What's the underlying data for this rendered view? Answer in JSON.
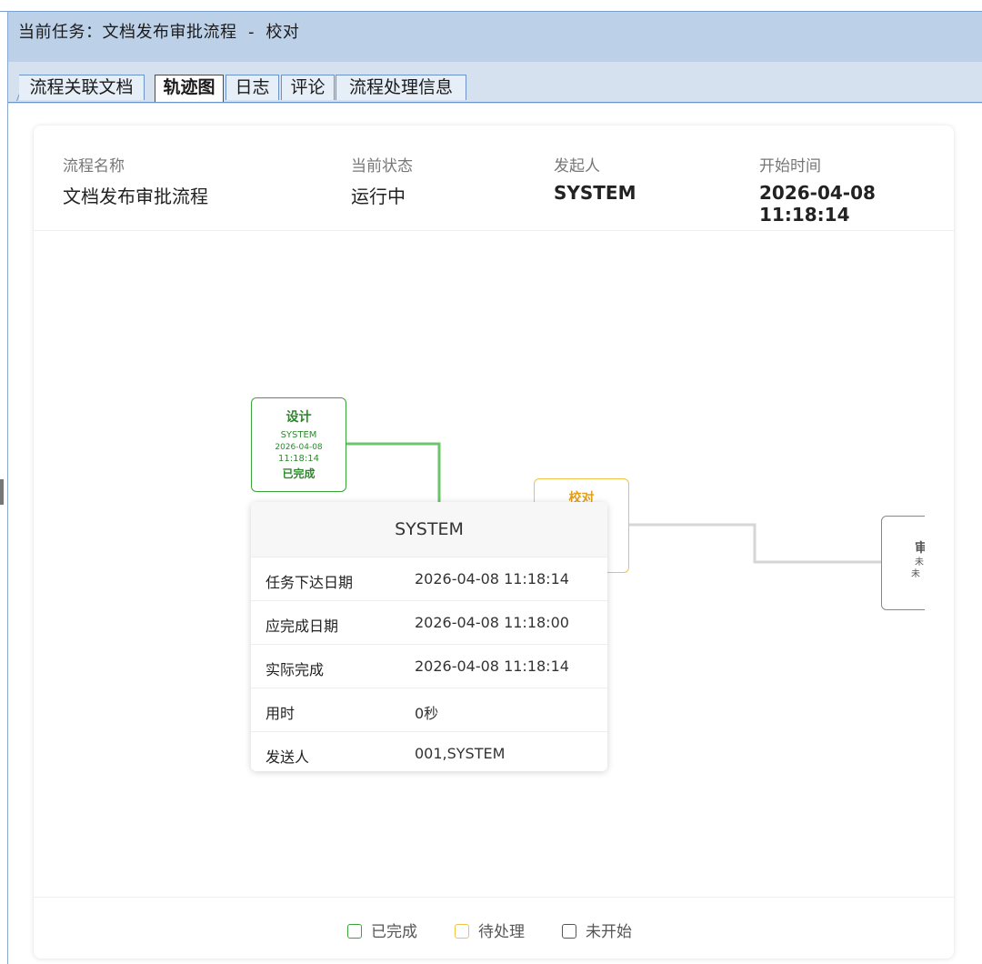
{
  "window": {
    "title": "当前任务：文档发布审批流程  -  校对"
  },
  "tabs": [
    {
      "label": "流程关联文档"
    },
    {
      "label": "轨迹图",
      "active": true
    },
    {
      "label": "日志"
    },
    {
      "label": "评论"
    },
    {
      "label": "流程处理信息"
    }
  ],
  "info": {
    "name_label": "流程名称",
    "name_value": "文档发布审批流程",
    "status_label": "当前状态",
    "status_value": "运行中",
    "initiator_label": "发起人",
    "initiator_value": "SYSTEM",
    "start_label": "开始时间",
    "start_value": "2026-04-08 11:18:14"
  },
  "nodes": {
    "design": {
      "title": "设计",
      "user": "SYSTEM",
      "date": "2026-04-08",
      "time": "11:18:14",
      "status": "已完成"
    },
    "proofread": {
      "title": "校对"
    },
    "review": {
      "title": "审",
      "line1": "未",
      "line2": "未"
    }
  },
  "popup": {
    "title": "SYSTEM",
    "rows": [
      {
        "key": "任务下达日期",
        "value": "2026-04-08 11:18:14"
      },
      {
        "key": "应完成日期",
        "value": "2026-04-08 11:18:00"
      },
      {
        "key": "实际完成",
        "value": "2026-04-08 11:18:14"
      },
      {
        "key": "用时",
        "value": "0秒"
      },
      {
        "key": "发送人",
        "value": "001,SYSTEM"
      }
    ]
  },
  "scrollbar": {
    "position": 0.64
  },
  "legend": {
    "done": "已完成",
    "pending": "待处理",
    "todo": "未开始"
  },
  "colors": {
    "done": "#3aa33a",
    "pending": "#f0c24a",
    "todo": "#888888",
    "titlebar": "#bcd0e8",
    "tabstrip": "#d5e1ef"
  }
}
